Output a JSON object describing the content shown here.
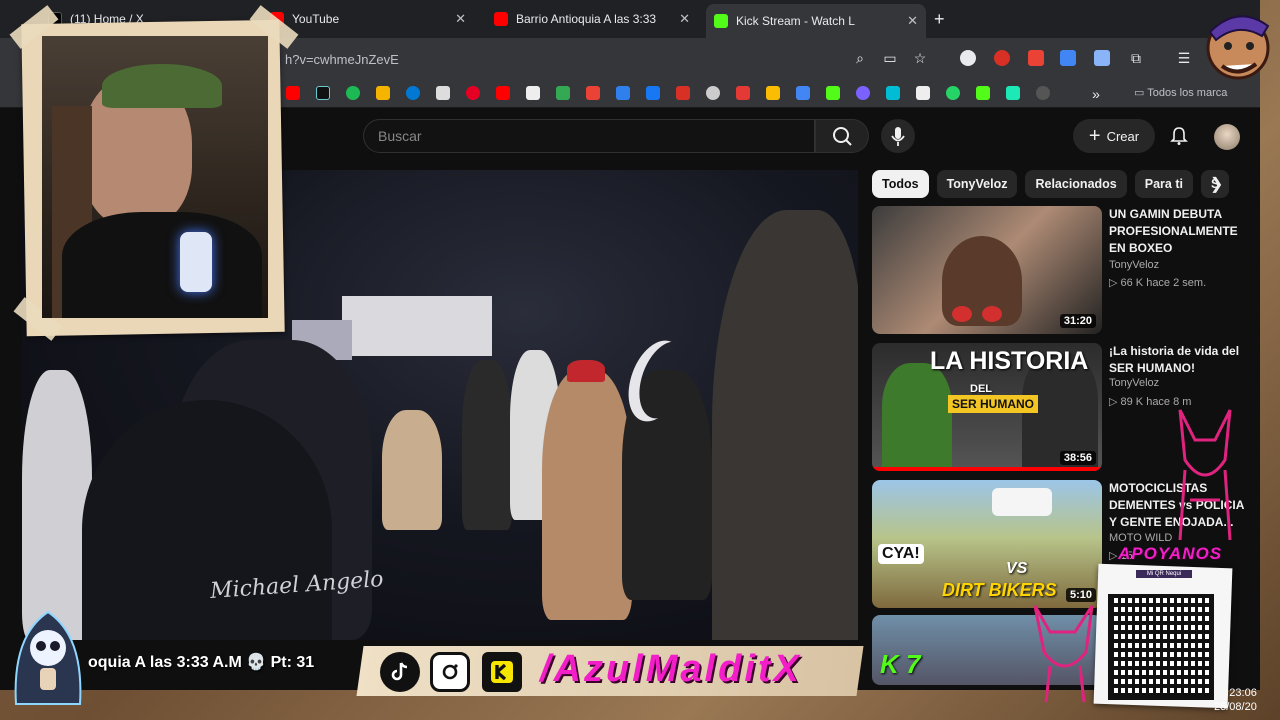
{
  "browser": {
    "tabs": [
      {
        "label": "(11) Home / X",
        "icon": "x-icon"
      },
      {
        "label": "YouTube",
        "icon": "youtube-icon"
      },
      {
        "label": "Barrio Antioquia A las 3:33",
        "icon": "youtube-icon"
      },
      {
        "label": "Kick Stream - Watch L",
        "icon": "kick-icon"
      }
    ],
    "new_tab": "+",
    "url": "h?v=cwhmeJnZevE",
    "bookmarks_folder": "Todos los marca"
  },
  "youtube": {
    "search_placeholder": "Buscar",
    "create_label": "Crear",
    "chips": [
      "Todos",
      "TonyVeloz",
      "Relacionados",
      "Para ti",
      "S"
    ],
    "recommendations": [
      {
        "title": "UN GAMIN DEBUTA PROFESIONALMENTE EN BOXEO",
        "channel": "TonyVeloz",
        "meta": "▷ 66 K  hace 2 sem.",
        "duration": "31:20"
      },
      {
        "title": "¡La historia de vida del SER HUMANO!",
        "channel": "TonyVeloz",
        "meta": "▷ 89 K  hace 8 m",
        "duration": "38:56",
        "thumb_text_1": "LA HISTORIA",
        "thumb_text_2": "DEL",
        "thumb_text_3": "SER HUMANO"
      },
      {
        "title": "MOTOCICLISTAS DEMENTES vs POLICIA Y GENTE ENOJADA...",
        "channel": "MOTO WILD",
        "meta": "▷ 15",
        "duration": "5:10",
        "thumb_text_1": "CYA!",
        "thumb_text_2": "VS",
        "thumb_text_3": "DIRT BIKERS"
      }
    ]
  },
  "video": {
    "jacket_text": "Michael Angelo"
  },
  "overlay": {
    "stream_title": "oquia A las 3:33 A.M 💀 Pt: 31",
    "handle": "/AzulMalditX",
    "apoyanos": "APOYANOS",
    "qr_label": "Mi QR Nequi",
    "kick_badge": "K 7",
    "clock_time": "23:06",
    "clock_date": "25/08/20"
  }
}
